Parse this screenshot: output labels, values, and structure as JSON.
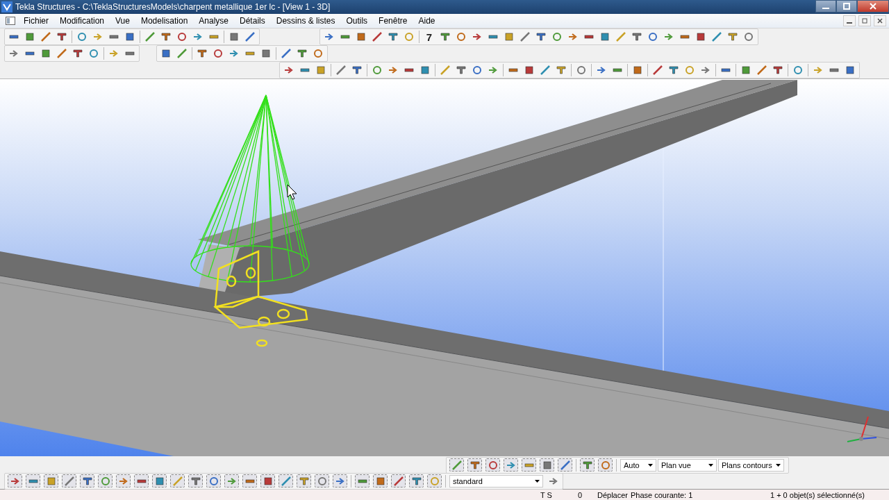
{
  "window": {
    "title": "Tekla Structures - C:\\TeklaStructuresModels\\charpent metallique 1er lc - [View 1 - 3D]"
  },
  "menu": [
    "Fichier",
    "Modification",
    "Vue",
    "Modelisation",
    "Analyse",
    "Détails",
    "Dessins & listes",
    "Outils",
    "Fenêtre",
    "Aide"
  ],
  "model_toolbar": {
    "step_label": "7"
  },
  "view_toolbar": {
    "dropdowns": [
      "Auto",
      "Plan vue",
      "Plans contours"
    ]
  },
  "select_toolbar": {
    "filter": "standard"
  },
  "status_bar": [
    "T S",
    "0",
    "Déplacer",
    "Phase courante: 1",
    "1 + 0 objet(s) sélectionné(s)"
  ]
}
